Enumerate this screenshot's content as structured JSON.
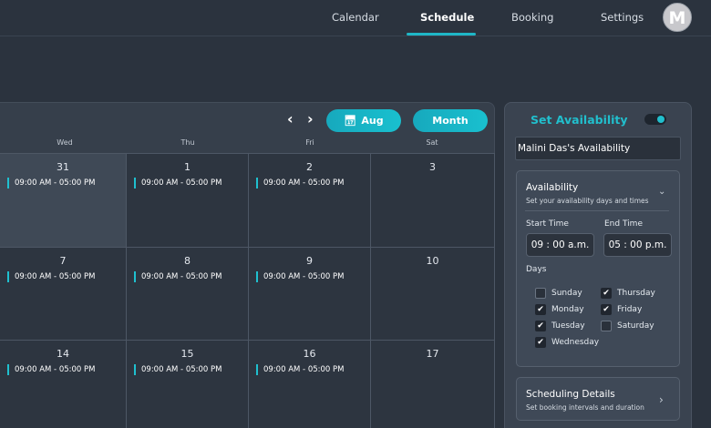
{
  "nav": {
    "items": [
      {
        "label": "Calendar"
      },
      {
        "label": "Schedule"
      },
      {
        "label": "Booking"
      },
      {
        "label": "Settings"
      }
    ],
    "active": "Schedule",
    "avatar_initial": "M"
  },
  "calendar": {
    "prev_icon": "chevron-left",
    "next_icon": "chevron-right",
    "month_button": "Aug",
    "month_button_icon": "calendar-icon",
    "view_button": "Month",
    "weekdays": [
      "Wed",
      "Thu",
      "Fri",
      "Sat"
    ],
    "rows": [
      {
        "days": [
          {
            "num": "31",
            "event": "09:00 AM - 05:00 PM"
          },
          {
            "num": "1",
            "event": "09:00 AM - 05:00 PM"
          },
          {
            "num": "2",
            "event": "09:00 AM - 05:00 PM"
          },
          {
            "num": "3",
            "event": ""
          }
        ]
      },
      {
        "days": [
          {
            "num": "7",
            "event": "09:00 AM - 05:00 PM"
          },
          {
            "num": "8",
            "event": "09:00 AM - 05:00 PM"
          },
          {
            "num": "9",
            "event": "09:00 AM - 05:00 PM"
          },
          {
            "num": "10",
            "event": ""
          }
        ]
      },
      {
        "days": [
          {
            "num": "14",
            "event": "09:00 AM - 05:00 PM"
          },
          {
            "num": "15",
            "event": "09:00 AM - 05:00 PM"
          },
          {
            "num": "16",
            "event": "09:00 AM - 05:00 PM"
          },
          {
            "num": "17",
            "event": ""
          }
        ]
      }
    ]
  },
  "availability": {
    "title": "Set Availability",
    "toggle_on": true,
    "name": "Malini Das's Availability",
    "section_title": "Availability",
    "section_subtitle": "Set your availability days and times",
    "start_label": "Start Time",
    "start_value": "09 : 00  a.m.",
    "end_label": "End Time",
    "end_value": "05 : 00  p.m.",
    "days_label": "Days",
    "days": [
      {
        "label": "Sunday",
        "checked": false
      },
      {
        "label": "Thursday",
        "checked": true
      },
      {
        "label": "Monday",
        "checked": true
      },
      {
        "label": "Friday",
        "checked": true
      },
      {
        "label": "Tuesday",
        "checked": true
      },
      {
        "label": "Saturday",
        "checked": false
      },
      {
        "label": "Wednesday",
        "checked": true
      }
    ],
    "scheduling_title": "Scheduling Details",
    "scheduling_subtitle": "Set booking intervals and duration"
  },
  "colors": {
    "accent": "#1fb7c7",
    "background": "#2b333e"
  }
}
